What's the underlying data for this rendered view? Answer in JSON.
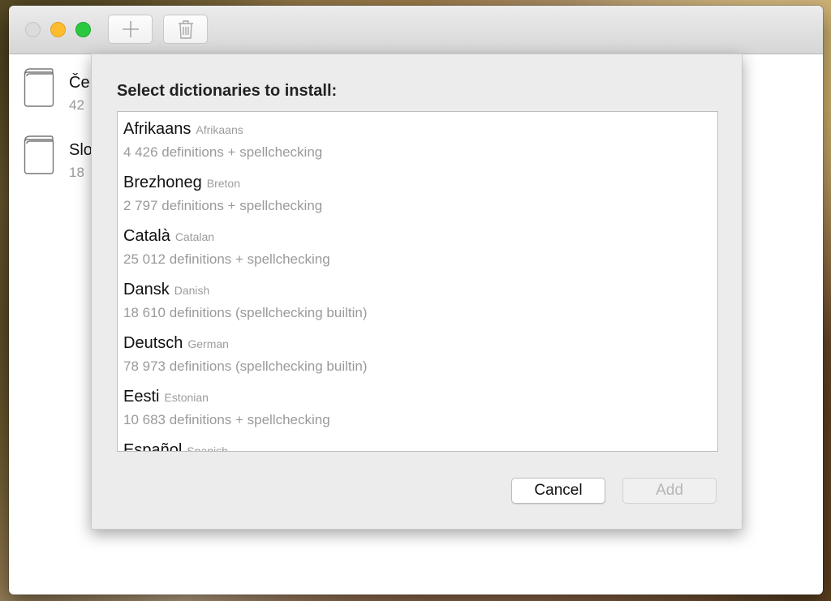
{
  "sidebar": {
    "items": [
      {
        "name": "Če",
        "count": "42"
      },
      {
        "name": "Slo",
        "count": "18"
      }
    ]
  },
  "dialog": {
    "title": "Select dictionaries to install:",
    "languages": [
      {
        "native": "Afrikaans",
        "english": "Afrikaans",
        "detail": "4 426 definitions + spellchecking"
      },
      {
        "native": "Brezhoneg",
        "english": "Breton",
        "detail": "2 797 definitions + spellchecking"
      },
      {
        "native": "Català",
        "english": "Catalan",
        "detail": "25 012 definitions + spellchecking"
      },
      {
        "native": "Dansk",
        "english": "Danish",
        "detail": "18 610 definitions (spellchecking builtin)"
      },
      {
        "native": "Deutsch",
        "english": "German",
        "detail": "78 973 definitions (spellchecking builtin)"
      },
      {
        "native": "Eesti",
        "english": "Estonian",
        "detail": "10 683 definitions + spellchecking"
      },
      {
        "native": "Español",
        "english": "Spanish",
        "detail": ""
      }
    ],
    "cancel_label": "Cancel",
    "add_label": "Add"
  }
}
